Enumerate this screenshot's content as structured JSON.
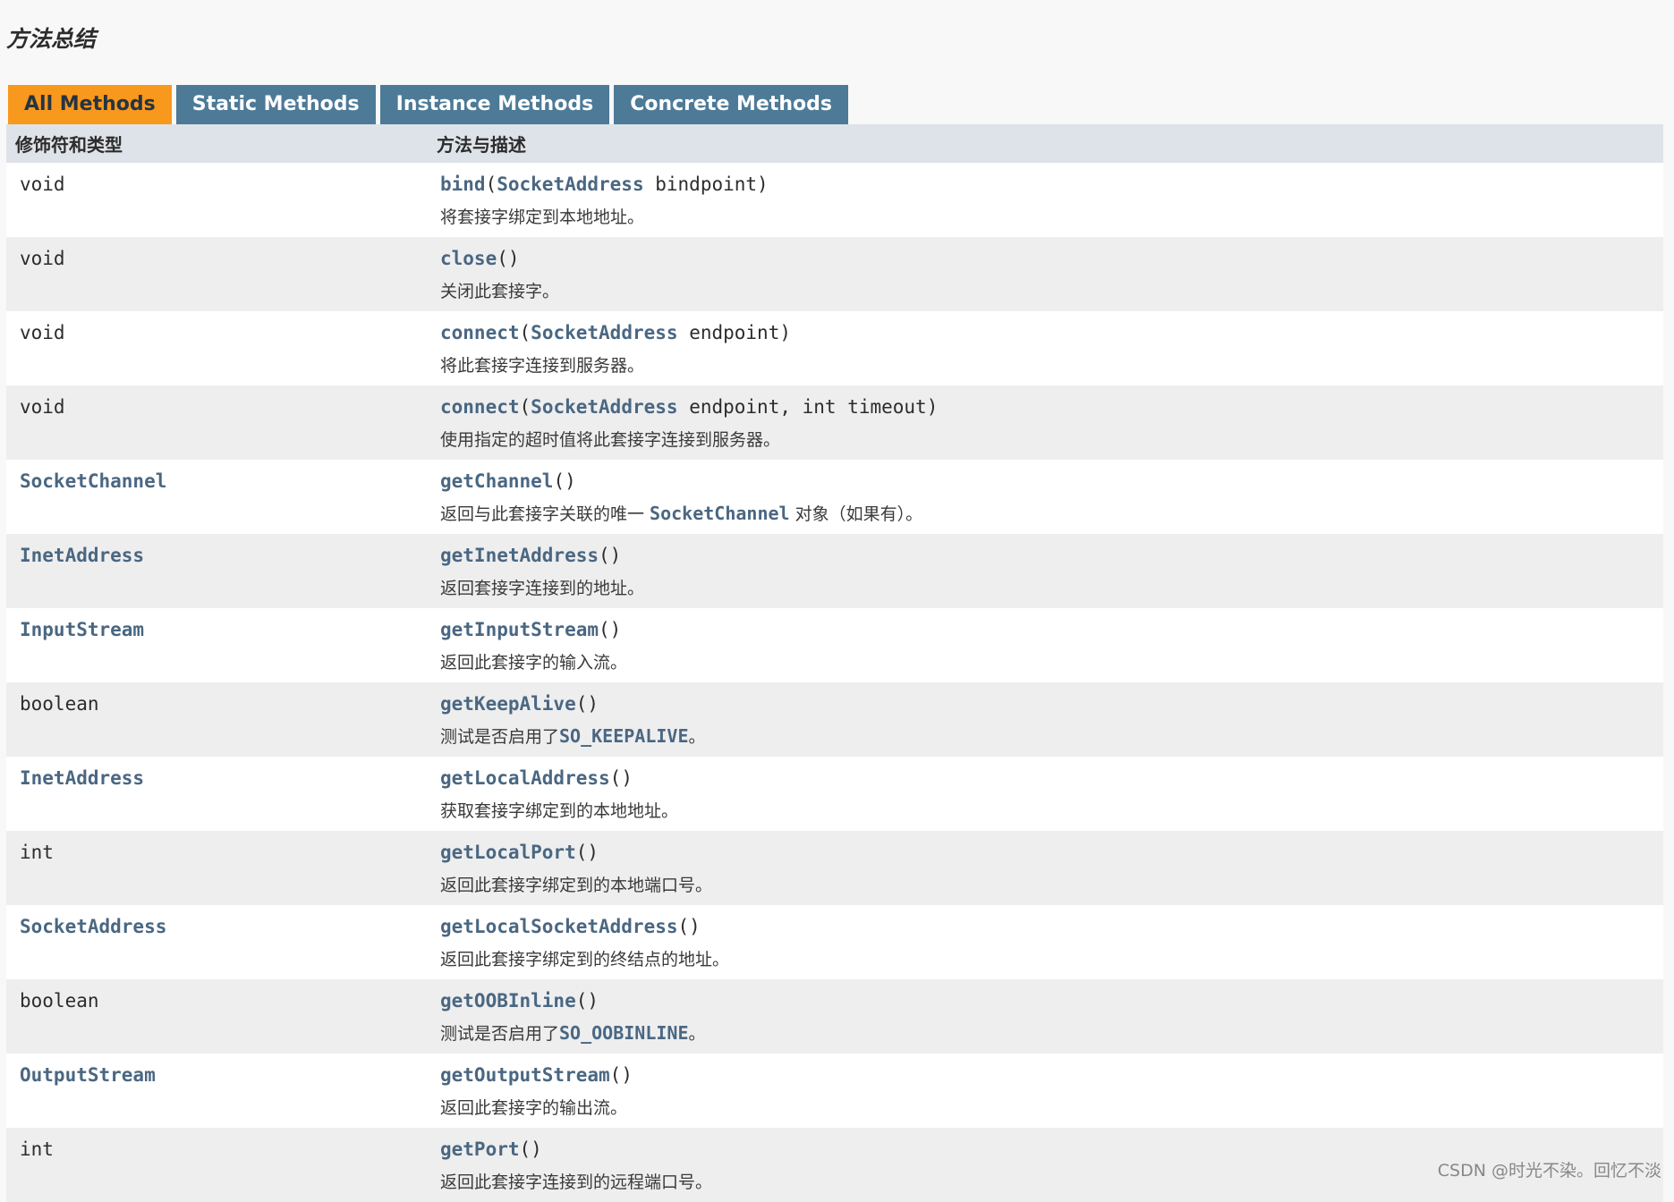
{
  "section_title": "方法总结",
  "tabs": [
    {
      "label": "All Methods"
    },
    {
      "label": "Static Methods"
    },
    {
      "label": "Instance Methods"
    },
    {
      "label": "Concrete Methods"
    }
  ],
  "table_headers": {
    "col1": "修饰符和类型",
    "col2": "方法与描述"
  },
  "rows": [
    {
      "type": "void",
      "method": "bind",
      "params": [
        "SocketAddress",
        " bindpoint"
      ],
      "desc": "将套接字绑定到本地地址。"
    },
    {
      "type": "void",
      "method": "close",
      "params": [],
      "desc": "关闭此套接字。"
    },
    {
      "type": "void",
      "method": "connect",
      "params": [
        "SocketAddress",
        " endpoint"
      ],
      "desc": "将此套接字连接到服务器。"
    },
    {
      "type": "void",
      "method": "connect",
      "params": [
        "SocketAddress",
        " endpoint, int timeout"
      ],
      "desc": "使用指定的超时值将此套接字连接到服务器。"
    },
    {
      "type": "SocketChannel",
      "method": "getChannel",
      "params": [],
      "desc_pre": "返回与此套接字关联的唯一 ",
      "desc_code": "SocketChannel",
      "desc_post": " 对象（如果有）。"
    },
    {
      "type": "InetAddress",
      "method": "getInetAddress",
      "params": [],
      "desc": "返回套接字连接到的地址。"
    },
    {
      "type": "InputStream",
      "method": "getInputStream",
      "params": [],
      "desc": "返回此套接字的输入流。"
    },
    {
      "type": "boolean",
      "method": "getKeepAlive",
      "params": [],
      "desc_pre": "测试是否启用了",
      "desc_code": "SO_KEEPALIVE",
      "desc_post": "。"
    },
    {
      "type": "InetAddress",
      "method": "getLocalAddress",
      "params": [],
      "desc": "获取套接字绑定到的本地地址。"
    },
    {
      "type": "int",
      "method": "getLocalPort",
      "params": [],
      "desc": "返回此套接字绑定到的本地端口号。"
    },
    {
      "type": "SocketAddress",
      "method": "getLocalSocketAddress",
      "params": [],
      "desc": "返回此套接字绑定到的终结点的地址。"
    },
    {
      "type": "boolean",
      "method": "getOOBInline",
      "params": [],
      "desc_pre": "测试是否启用了",
      "desc_code": "SO_OOBINLINE",
      "desc_post": "。"
    },
    {
      "type": "OutputStream",
      "method": "getOutputStream",
      "params": [],
      "desc": "返回此套接字的输出流。"
    },
    {
      "type": "int",
      "method": "getPort",
      "params": [],
      "desc": "返回此套接字连接到的远程端口号。"
    }
  ],
  "watermark": "CSDN @时光不染。回忆不淡"
}
